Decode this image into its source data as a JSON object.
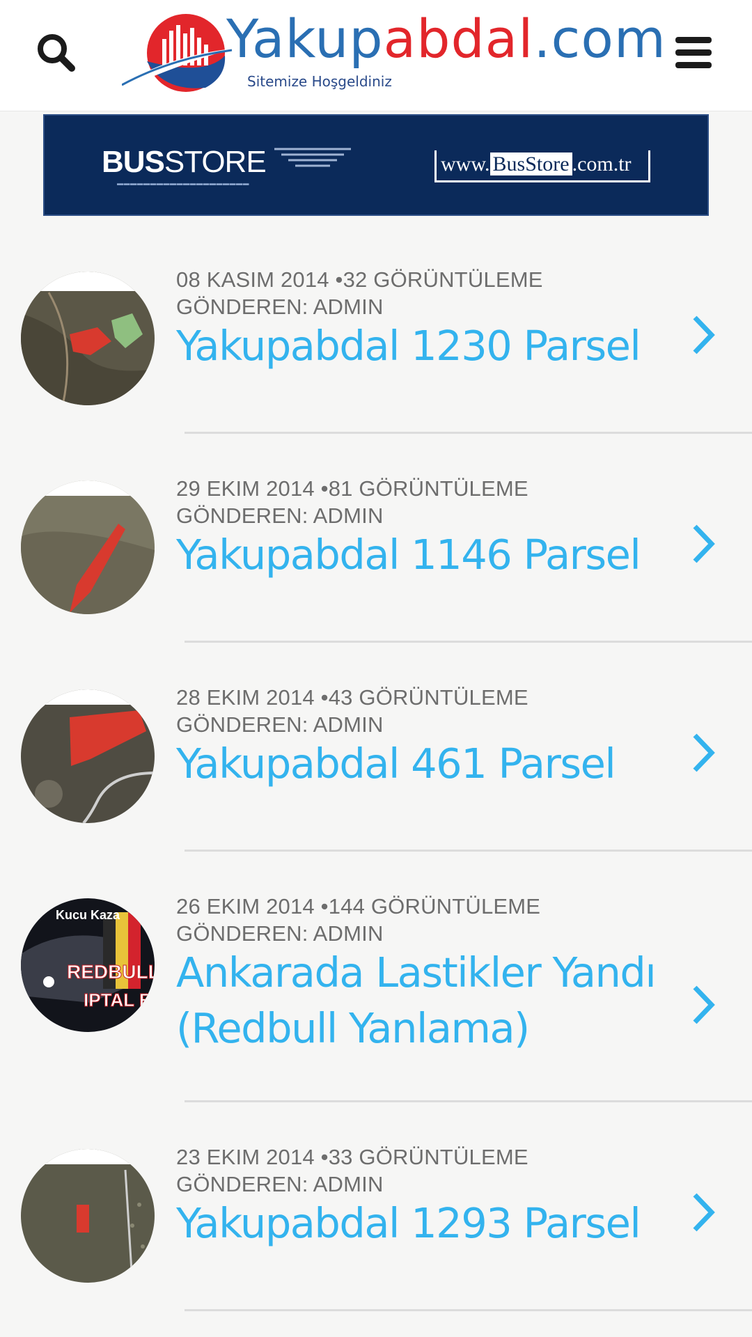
{
  "header": {
    "logo_main": "Yakup",
    "logo_accent": "abdal",
    "logo_suffix": ".com",
    "tagline": "Sitemize Hoşgeldiniz"
  },
  "banner": {
    "brand_bold": "BUS",
    "brand_thin": "STORE",
    "url_prefix": "www.",
    "url_brand": "BusStore",
    "url_suffix": ".com.tr"
  },
  "posts": [
    {
      "date_views": "08 KASIM 2014 •32 GÖRÜNTÜLEME",
      "author": "GÖNDEREN: ADMIN",
      "title": "Yakupabdal 1230 Parsel",
      "thumb": "map-thumb"
    },
    {
      "date_views": "29 EKIM 2014 •81 GÖRÜNTÜLEME",
      "author": "GÖNDEREN: ADMIN",
      "title": "Yakupabdal 1146 Parsel",
      "thumb": "map-thumb"
    },
    {
      "date_views": "28 EKIM 2014 •43 GÖRÜNTÜLEME",
      "author": "GÖNDEREN: ADMIN",
      "title": "Yakupabdal 461 Parsel",
      "thumb": "map-thumb"
    },
    {
      "date_views": "26 EKIM 2014 •144 GÖRÜNTÜLEME",
      "author": "GÖNDEREN: ADMIN",
      "title": "Ankarada Lastikler Yandı (Redbull Yanlama)",
      "thumb": "redbull-thumb",
      "thumb_text_line1": "REDBULL DRIFT",
      "thumb_text_line2": "IPTAL EDILDI",
      "thumb_text_top": "Kucu Kaza"
    },
    {
      "date_views": "23 EKIM 2014 •33 GÖRÜNTÜLEME",
      "author": "GÖNDEREN: ADMIN",
      "title": "Yakupabdal 1293 Parsel",
      "thumb": "map-thumb"
    }
  ],
  "colors": {
    "accent": "#33b3ee",
    "meta": "#6d6d6d",
    "background": "#f6f6f5",
    "banner": "#0b2a5a"
  }
}
